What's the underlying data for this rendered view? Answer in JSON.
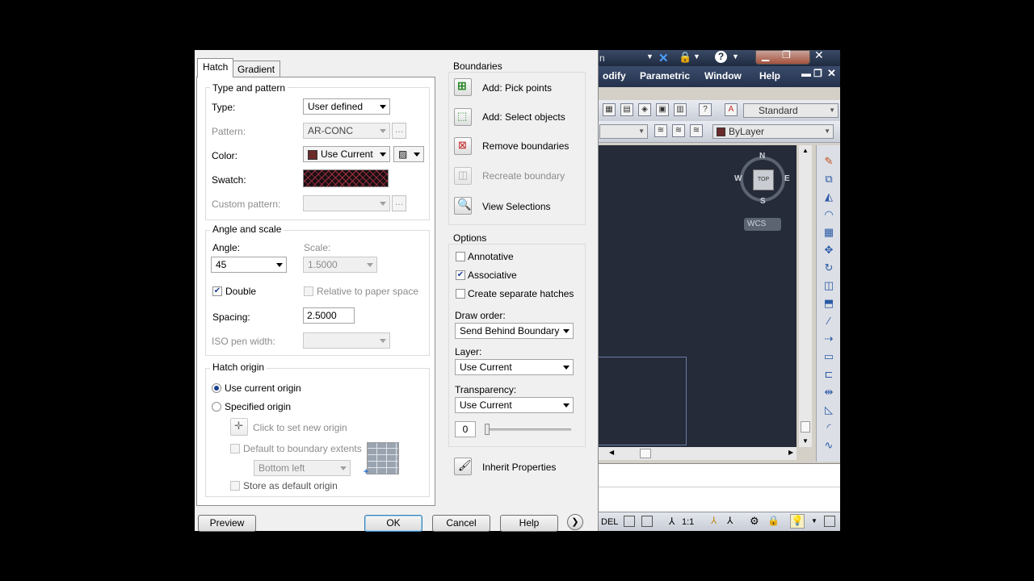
{
  "dialog": {
    "tabs": [
      {
        "label": "Hatch"
      },
      {
        "label": "Gradient"
      }
    ],
    "type_pattern": {
      "title": "Type and pattern",
      "type_label": "Type:",
      "type_value": "User defined",
      "pattern_label": "Pattern:",
      "pattern_value": "AR-CONC",
      "color_label": "Color:",
      "color_value": "Use Current",
      "swatch_label": "Swatch:",
      "custom_label": "Custom pattern:",
      "custom_value": ""
    },
    "angle_scale": {
      "title": "Angle and scale",
      "angle_label": "Angle:",
      "angle_value": "45",
      "scale_label": "Scale:",
      "scale_value": "1.5000",
      "double_label": "Double",
      "double_checked": true,
      "relative_label": "Relative to paper space",
      "spacing_label": "Spacing:",
      "spacing_value": "2.5000",
      "iso_label": "ISO pen width:",
      "iso_value": ""
    },
    "origin": {
      "title": "Hatch origin",
      "current_label": "Use current origin",
      "specified_label": "Specified origin",
      "click_label": "Click to set new origin",
      "default_extents_label": "Default to boundary extents",
      "position_value": "Bottom left",
      "store_label": "Store as default origin"
    },
    "boundaries": {
      "title": "Boundaries",
      "pick_label": "Add: Pick points",
      "select_label": "Add: Select objects",
      "remove_label": "Remove boundaries",
      "recreate_label": "Recreate boundary",
      "view_label": "View Selections"
    },
    "options": {
      "title": "Options",
      "annotative_label": "Annotative",
      "associative_label": "Associative",
      "associative_checked": true,
      "separate_label": "Create separate hatches",
      "draw_order_label": "Draw order:",
      "draw_order_value": "Send Behind Boundary",
      "layer_label": "Layer:",
      "layer_value": "Use Current",
      "transparency_label": "Transparency:",
      "transparency_value": "Use Current",
      "transparency_amount": "0"
    },
    "inherit_label": "Inherit Properties",
    "buttons": {
      "preview": "Preview",
      "ok": "OK",
      "cancel": "Cancel",
      "help": "Help"
    }
  },
  "acad": {
    "title_fragment": "n",
    "ribbon": {
      "modify": "odify",
      "parametric": "Parametric",
      "window": "Window",
      "help": "Help"
    },
    "style_value": "Standard",
    "layer_value": "ByLayer",
    "navcube": {
      "n": "N",
      "s": "S",
      "e": "E",
      "w": "W",
      "top": "TOP",
      "wcs": "WCS"
    },
    "status": {
      "model": "DEL",
      "scale": "1:1"
    }
  },
  "colors": {
    "accent": "#1b3f8f",
    "viewport": "#252b38",
    "ribbon": "#2e3e5c",
    "color_chip": "#6b2a2a"
  }
}
